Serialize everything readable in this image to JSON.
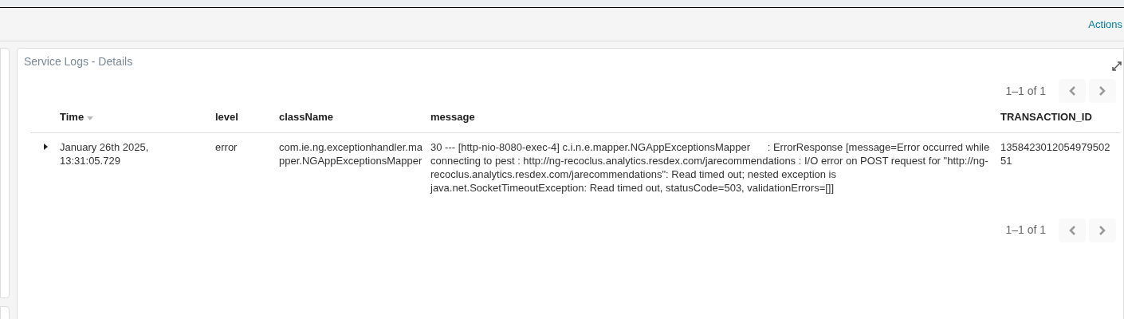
{
  "toolbar": {
    "actions_link": "Actions"
  },
  "panel": {
    "title": "Service Logs - Details",
    "pagination_top": {
      "range": "1–1 of 1"
    },
    "table": {
      "columns": [
        {
          "label": "Time",
          "sorted": true
        },
        {
          "label": "level",
          "sorted": false
        },
        {
          "label": "className",
          "sorted": false
        },
        {
          "label": "message",
          "sorted": false
        },
        {
          "label": "TRANSACTION_ID",
          "sorted": false
        }
      ],
      "rows": [
        {
          "expanded": false,
          "cells": [
            "January 26th 2025, 13:31:05.729",
            "error",
            "com.ie.ng.exceptionhandler.mapper.NGAppExceptionsMapper",
            "30 --- [http-nio-8080-exec-4] c.i.n.e.mapper.NGAppExceptionsMapper      : ErrorResponse [message=Error occurred while connecting to pest : http://ng-recoclus.analytics.resdex.com/jarecommendations : I/O error on POST request for \"http://ng-recoclus.analytics.resdex.com/jarecommendations\": Read timed out; nested exception is java.net.SocketTimeoutException: Read timed out, statusCode=503, validationErrors=[]]",
            "135842301205497950251"
          ]
        }
      ]
    },
    "pagination_bottom": {
      "range": "1–1 of 1"
    }
  }
}
